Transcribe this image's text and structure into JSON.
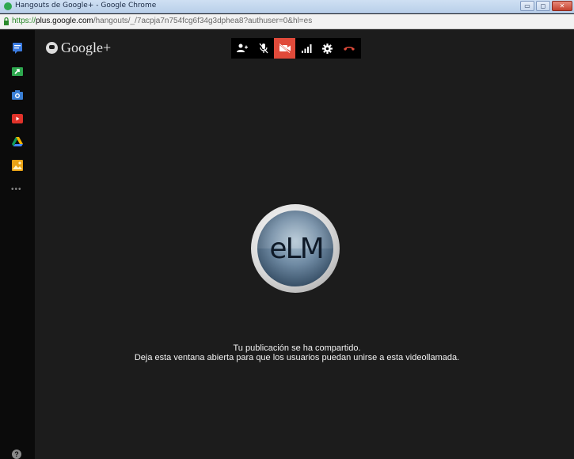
{
  "window": {
    "title": "Hangouts de Google+ - Google Chrome",
    "controls": {
      "minimize": "▭",
      "maximize": "◻",
      "close": "✕"
    }
  },
  "address_bar": {
    "scheme": "https://",
    "host": "plus.google.com",
    "path": "/hangouts/_/7acpja7n754fcg6f34g3dphea8?authuser=0&hl=es"
  },
  "sidebar": {
    "items": [
      {
        "icon": "chat-icon",
        "color": "#3b7be0"
      },
      {
        "icon": "screenshare-icon",
        "color": "#2ea84f"
      },
      {
        "icon": "camera-icon",
        "color": "#3a7fd4"
      },
      {
        "icon": "youtube-icon",
        "color": "#e0322a"
      },
      {
        "icon": "drive-icon",
        "color": "#f4b400"
      },
      {
        "icon": "photo-icon",
        "color": "#e9a316"
      }
    ],
    "more": "•••",
    "help": "?"
  },
  "logo": {
    "label": "Google+"
  },
  "toolbar": {
    "buttons": [
      {
        "icon": "invite-people-icon"
      },
      {
        "icon": "mute-mic-icon"
      },
      {
        "icon": "camera-off-icon",
        "active": true,
        "color": "#e04a3a"
      },
      {
        "icon": "bandwidth-icon"
      },
      {
        "icon": "settings-icon"
      },
      {
        "icon": "hang-up-icon",
        "color": "#e04a3a"
      }
    ]
  },
  "avatar": {
    "monogram": "eLM"
  },
  "messages": {
    "line1": "Tu publicación se ha compartido.",
    "line2": "Deja esta ventana abierta para que los usuarios puedan unirse a esta videollamada."
  }
}
